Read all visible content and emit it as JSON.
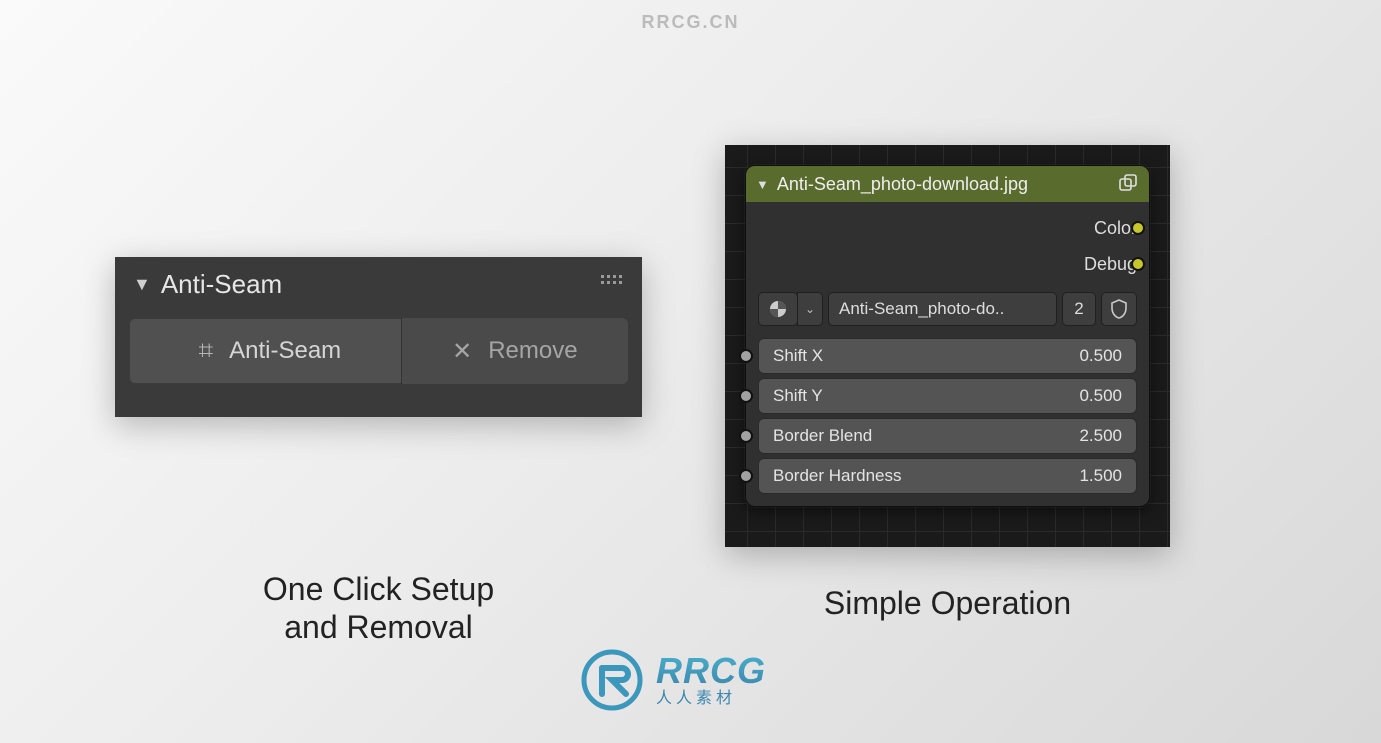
{
  "watermark_top": "RRCG.CN",
  "panel": {
    "title": "Anti-Seam",
    "apply_label": "Anti-Seam",
    "remove_label": "Remove"
  },
  "caption_left_line1": "One Click Setup",
  "caption_left_line2": "and Removal",
  "node": {
    "title": "Anti-Seam_photo-download.jpg",
    "outputs": [
      {
        "label": "Color"
      },
      {
        "label": "Debug"
      }
    ],
    "material_name": "Anti-Seam_photo-do..",
    "users": "2",
    "inputs": [
      {
        "label": "Shift X",
        "value": "0.500"
      },
      {
        "label": "Shift Y",
        "value": "0.500"
      },
      {
        "label": "Border Blend",
        "value": "2.500"
      },
      {
        "label": "Border Hardness",
        "value": "1.500"
      }
    ]
  },
  "caption_right": "Simple Operation",
  "rrcg": {
    "brand": "RRCG",
    "tagline": "人人素材"
  }
}
